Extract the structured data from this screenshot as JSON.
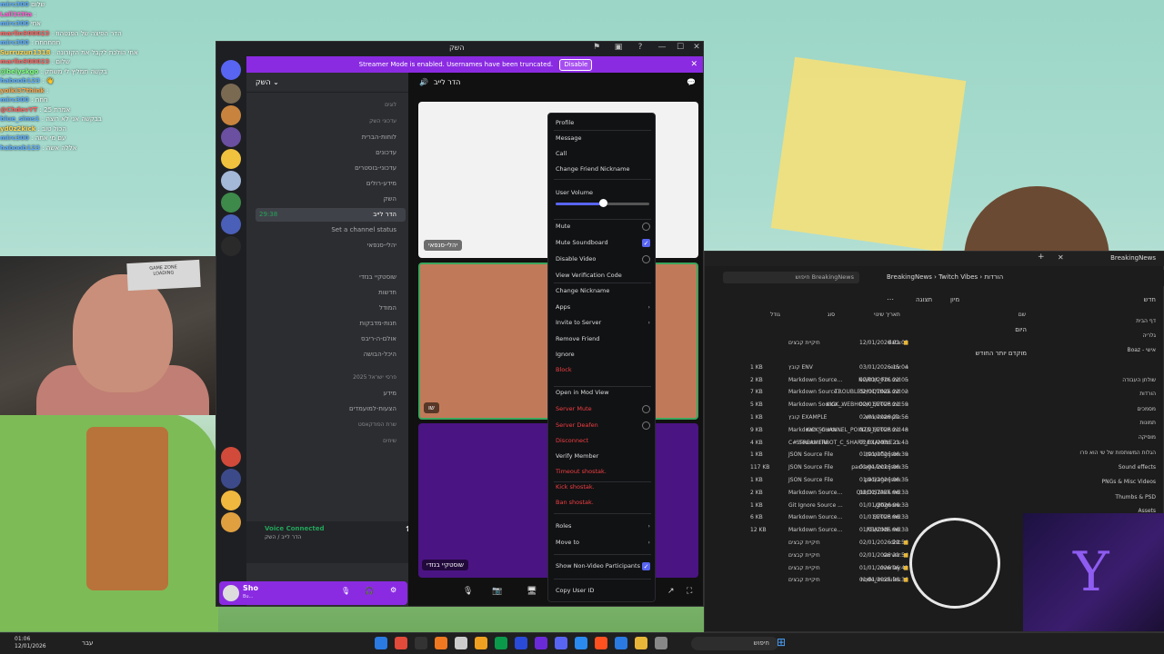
{
  "chat": [
    {
      "user": "mirc300",
      "color": "#5da9ff",
      "text": "שלום"
    },
    {
      "user": "Lail1t3ta",
      "color": "#ff5fd1",
      "text": ":"
    },
    {
      "user": "mirc300",
      "color": "#5da9ff",
      "text": "אחי"
    },
    {
      "user": "marlin900023",
      "color": "#ff6060",
      "text": ": הדר הפיצה של הפנטהוז"
    },
    {
      "user": "mirc300",
      "color": "#5da9ff",
      "text": ": חחחחחח"
    },
    {
      "user": "Surruzun1318",
      "color": "#ffd24d",
      "text": ": אחי הולכת לקבל את הקורונה"
    },
    {
      "user": "marlin900023",
      "color": "#ff6060",
      "text": ": שלום"
    },
    {
      "user": "@belyskgo",
      "color": "#7cff7c",
      "text": ": בקשה תמליץ לי משחק"
    },
    {
      "user": "haboob123",
      "color": "#5da9ff",
      "text": ": 👋"
    },
    {
      "user": "yoiki37think",
      "color": "#ff9f40",
      "text": ": "
    },
    {
      "user": "mirc300",
      "color": "#5da9ff",
      "text": ": חחח"
    },
    {
      "user": "@ChdevYT",
      "color": "#ff6060",
      "text": ": 25 אמרת"
    },
    {
      "user": "blue_sims1",
      "color": "#5da9ff",
      "text": ": בבקשה אני לא רוצה"
    },
    {
      "user": "yd0z2kick",
      "color": "#ffd24d",
      "text": ": הכול טוב"
    },
    {
      "user": "mirc300",
      "color": "#5da9ff",
      "text": ": עם מי אתה"
    },
    {
      "user": "haboob123",
      "color": "#5da9ff",
      "text": ": אללה אשה"
    }
  ],
  "webcam": {
    "sign_line1": "GAME ZONE",
    "sign_line2": "LOADING"
  },
  "discord": {
    "title": "השק",
    "banner_text": "Streamer Mode is enabled. Usernames have been truncated.",
    "banner_button": "Disable",
    "server_name": "השק",
    "channels": [
      {
        "label": "לוגים",
        "cat": true
      },
      {
        "label": "עדכוני השק",
        "cat": true
      },
      {
        "label": "לוחות-הברית"
      },
      {
        "label": "עדכונים"
      },
      {
        "label": "עדכוני-בוסטרים"
      },
      {
        "label": "מידע-רולים"
      },
      {
        "label": "השק"
      },
      {
        "label": "הדר לייב",
        "active": true,
        "time": "29:38"
      },
      {
        "label": "Set a channel status"
      },
      {
        "label": "יהלי-סנפאי"
      },
      {
        "label": "שוסטקיי בנזדי"
      },
      {
        "label": "חדשות"
      },
      {
        "label": "המודל"
      },
      {
        "label": "חנות-מדבקות"
      },
      {
        "label": "אולם-ה-ריבס"
      },
      {
        "label": "היכל-הבושה"
      },
      {
        "label": "פרסי ישראל 2025",
        "cat": true
      },
      {
        "label": "מידע"
      },
      {
        "label": "הצעות-למועמדים"
      },
      {
        "label": "שרת הפודקאסט",
        "cat": true
      },
      {
        "label": "שיחים",
        "cat": true
      }
    ],
    "voice_status": "Voice Connected",
    "voice_sub": "הדר לייב / השק",
    "user_name": "Sho",
    "user_status": "Bu...",
    "call_title": "הדר לייב",
    "tile1_tag": "יהלי-סנפאי",
    "tile2_tag": "שו",
    "tile3_tag": "שוסטקיי בנזדי"
  },
  "context_menu": {
    "items": [
      {
        "label": "Profile"
      },
      {
        "label": "Message"
      },
      {
        "label": "Call"
      },
      {
        "label": "Change Friend Nickname"
      },
      {
        "label": "User Volume"
      },
      {
        "label": "Mute",
        "check": "off"
      },
      {
        "label": "Mute Soundboard",
        "check": "on"
      },
      {
        "label": "Disable Video",
        "check": "off"
      },
      {
        "label": "View Verification Code"
      },
      {
        "label": "Change Nickname"
      },
      {
        "label": "Apps",
        "arrow": true
      },
      {
        "label": "Invite to Server",
        "arrow": true
      },
      {
        "label": "Remove Friend"
      },
      {
        "label": "Ignore"
      },
      {
        "label": "Block",
        "red": true
      },
      {
        "label": "Open in Mod View"
      },
      {
        "label": "Server Mute",
        "red": true,
        "check": "off"
      },
      {
        "label": "Server Deafen",
        "red": true,
        "check": "off"
      },
      {
        "label": "Disconnect",
        "red": true
      },
      {
        "label": "Verify Member"
      },
      {
        "label": "Timeout shostak.",
        "red": true
      },
      {
        "label": "Kick shostak.",
        "red": true
      },
      {
        "label": "Ban shostak.",
        "red": true
      },
      {
        "label": "Roles",
        "arrow": true
      },
      {
        "label": "Move to",
        "arrow": true
      },
      {
        "label": "Show Non-Video Participants",
        "check": "on"
      },
      {
        "label": "Copy User ID"
      }
    ],
    "user_volume": 0.5
  },
  "explorer": {
    "tab_title": "BreakingNews",
    "breadcrumb": [
      "BreakingNews",
      "Twitch Vibes",
      "הורדות"
    ],
    "search_placeholder": "חיפוש BreakingNews",
    "toolbar": {
      "new": "חדש",
      "sort": "מיון",
      "view": "תצוגה"
    },
    "headers": {
      "name": "שם",
      "date": "תאריך שינוי",
      "type": "סוג",
      "size": "גודל"
    },
    "groups": {
      "today": "היום",
      "earlier": "מוקדם יותר החודש"
    },
    "files": [
      {
        "name": "data",
        "date": "12/01/2026 01:03",
        "type": "תיקיית קבצים",
        "size": "",
        "group": "today"
      },
      {
        "name": ".env",
        "date": "03/01/2026 15:04",
        "type": "קובץ ENV",
        "size": "1 KB",
        "group": "earlier"
      },
      {
        "name": "NGROK_FIX.md",
        "date": "02/01/2026 22:05",
        "type": "Markdown Source...",
        "size": "2 KB"
      },
      {
        "name": "TROUBLESHOOTING.md",
        "date": "02/01/2026 22:02",
        "type": "Markdown Source...",
        "size": "7 KB"
      },
      {
        "name": "KICK_WEBHOOK_SETUP.md",
        "date": "02/01/2026 21:59",
        "type": "Markdown Source...",
        "size": "5 KB"
      },
      {
        "name": "env.example",
        "date": "02/01/2026 21:56",
        "type": "קובץ EXAMPLE",
        "size": "1 KB"
      },
      {
        "name": "KICK_CHANNEL_POINTS_SETUP.md",
        "date": "02/01/2026 21:48",
        "type": "Markdown Source...",
        "size": "9 KB"
      },
      {
        "name": "STREAMERBOT_C_SHARP_EXAMPLE.cs",
        "date": "02/01/2026 21:43",
        "type": "C# Source File",
        "size": "4 KB"
      },
      {
        "name": "tsconfig.json",
        "date": "01/01/2026 06:39",
        "type": "JSON Source File",
        "size": "1 KB"
      },
      {
        "name": "package-lock.json",
        "date": "01/01/2026 06:35",
        "type": "JSON Source File",
        "size": "117 KB"
      },
      {
        "name": "package.json",
        "date": "01/01/2026 06:35",
        "type": "JSON Source File",
        "size": "1 KB"
      },
      {
        "name": "QUICKSTART.md",
        "date": "01/01/2026 06:33",
        "type": "Markdown Source...",
        "size": "2 KB"
      },
      {
        "name": ".gitignore",
        "date": "01/01/2026 06:33",
        "type": "Git Ignore Source ...",
        "size": "1 KB"
      },
      {
        "name": "SETUP.md",
        "date": "01/01/2026 06:33",
        "type": "Markdown Source...",
        "size": "6 KB"
      },
      {
        "name": "README.md",
        "date": "01/01/2026 06:33",
        "type": "Markdown Source...",
        "size": "12 KB"
      },
      {
        "name": "dist",
        "date": "02/01/2026 21:56",
        "type": "תיקיית קבצים",
        "size": ""
      },
      {
        "name": "server",
        "date": "02/01/2026 21:54",
        "type": "תיקיית קבצים",
        "size": ""
      },
      {
        "name": "overlay",
        "date": "01/01/2026 06:41",
        "type": "תיקיית קבצים",
        "size": ""
      },
      {
        "name": "node_modules",
        "date": "01/01/2026 06:36",
        "type": "תיקיית קבצים",
        "size": ""
      }
    ],
    "nav": [
      "דף הבית",
      "גלריה",
      "Boaz - אישי",
      "שולחן העבודה",
      "הורדות",
      "מסמכים",
      "תמונות",
      "מוסיקה",
      "הגלות המשותפות של שי הוא פרו",
      "Sound effects",
      "PNGs & Misc Videos",
      "Thumbs & PSD",
      "Assets"
    ]
  },
  "taskbar": {
    "time": "01:06",
    "date": "12/01/2026",
    "lang": "עבר",
    "search": "חיפוש"
  }
}
